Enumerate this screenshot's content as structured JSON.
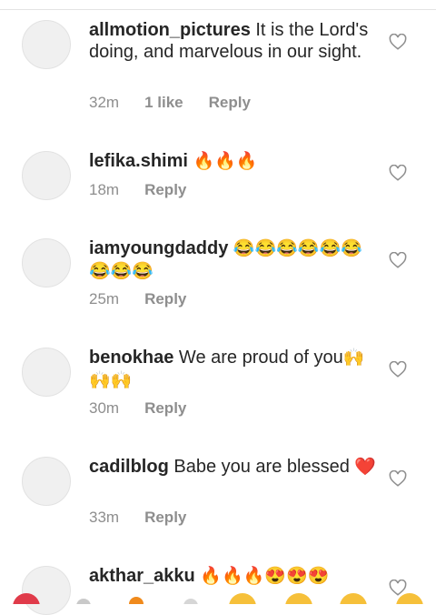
{
  "comments": [
    {
      "username": "allmotion_pictures",
      "text": "It is the Lord's doing, and marvelous in our sight.",
      "emoji": "",
      "time": "32m",
      "likes": "1 like",
      "reply": "Reply"
    },
    {
      "username": "lefika.shimi",
      "text": "",
      "emoji": "🔥🔥🔥",
      "time": "18m",
      "likes": "",
      "reply": "Reply"
    },
    {
      "username": "iamyoungdaddy",
      "text": "",
      "emoji": "😂😂😂😂😂😂😂😂😂",
      "time": "25m",
      "likes": "",
      "reply": "Reply"
    },
    {
      "username": "benokhae",
      "text": "We are proud of you",
      "emoji": "🙌🙌🙌",
      "time": "30m",
      "likes": "",
      "reply": "Reply"
    },
    {
      "username": "cadilblog",
      "text": "Babe you are blessed",
      "emoji": "❤️",
      "time": "33m",
      "likes": "",
      "reply": "Reply"
    },
    {
      "username": "akthar_akku",
      "text": "",
      "emoji": "🔥🔥🔥😍😍😍",
      "time": "",
      "likes": "",
      "reply": ""
    }
  ],
  "icons": {
    "like": "heart-outline-icon",
    "avatar": "avatar-placeholder"
  },
  "colors": {
    "text": "#262626",
    "meta": "#8e8e8e",
    "icon": "#8e8e8e",
    "avatar": "#f0f0f0"
  }
}
